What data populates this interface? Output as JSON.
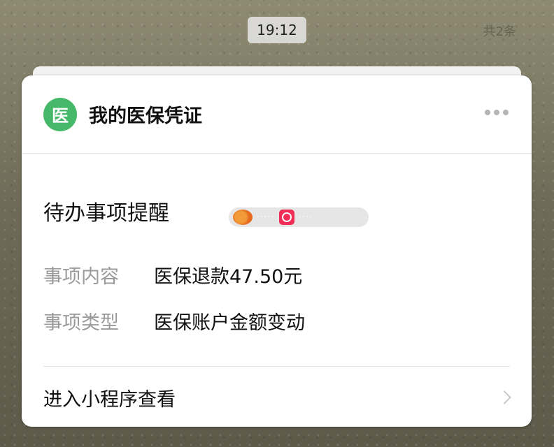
{
  "status": {
    "time": "19:12",
    "counter": "共2条"
  },
  "card": {
    "app_icon_char": "医",
    "app_name": "我的医保凭证",
    "reminder_title": "待办事项提醒",
    "fields": [
      {
        "label": "事项内容",
        "value": "医保退款47.50元"
      },
      {
        "label": "事项类型",
        "value": "医保账户金额变动"
      }
    ],
    "enter_label": "进入小程序查看",
    "more_icon": "more-dots-icon",
    "chevron_icon": "chevron-right-icon"
  },
  "colors": {
    "logo_green": "#45b86a",
    "label_gray": "#9a9a9a"
  }
}
